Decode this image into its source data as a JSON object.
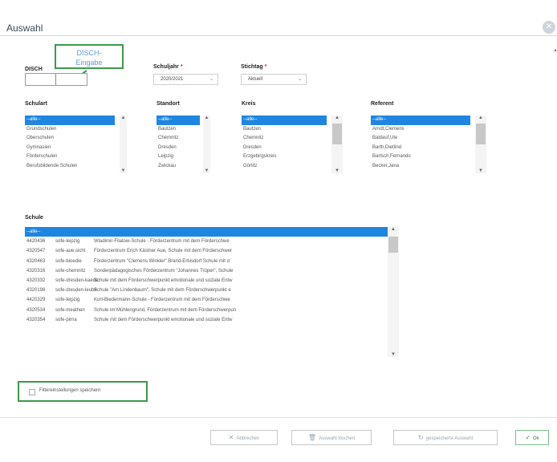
{
  "window": {
    "title": "Auswahl"
  },
  "callout": {
    "line1": "DISCH-",
    "line2": "Eingabe"
  },
  "fields": {
    "disch_label": "DISCH",
    "schuljahr_label": "Schuljahr",
    "schuljahr_value": "2020/2021",
    "stichtag_label": "Stichtag",
    "stichtag_value": "Aktuell",
    "required_mark": "*"
  },
  "lists": {
    "schulart": {
      "label": "Schulart",
      "items": [
        "--alle--",
        "Grundschulen",
        "Oberschulen",
        "Gymnasien",
        "Förderschulen",
        "Berufsbildende Schulen"
      ]
    },
    "standort": {
      "label": "Standort",
      "items": [
        "--alle--",
        "Bautzen",
        "Chemnitz",
        "Dresden",
        "Leipzig",
        "Zwickau"
      ]
    },
    "kreis": {
      "label": "Kreis",
      "items": [
        "--alle--",
        "Bautzen",
        "Chemnitz",
        "Dresden",
        "Erzgebirgskreis",
        "Görlitz"
      ]
    },
    "referent": {
      "label": "Referent",
      "items": [
        "--alle--",
        "Arndt,Clemens",
        "Baldauf,Ute",
        "Barth,Dietlind",
        "Bartsch,Fernando",
        "Becker,Jana"
      ]
    }
  },
  "schule": {
    "label": "Schule",
    "all_item": "--alle--",
    "rows": [
      {
        "id": "4420436",
        "code": "sofe-leipzig",
        "name": "Wladimir-Filatow-Schule - Förderzentrum mit dem Förderschwe"
      },
      {
        "id": "4320547",
        "code": "sofe-aue.sicht",
        "name": "Förderzentrum Erich Kästner Aue, Schule mit dem Förderschwer"
      },
      {
        "id": "4320463",
        "code": "sofe-bioedie",
        "name": "Förderzentrum \"Clemens Winkler\" Brand-Erbisdorf Schule mit d"
      },
      {
        "id": "4320316",
        "code": "sofe-chemnitz",
        "name": "Sonderpädagogisches Förderzentrum \"Johannes Trüper\", Schule"
      },
      {
        "id": "4320332",
        "code": "sofe-dresden-kaede",
        "name": "Schule mit dem Förderschwerpunkt emotionale und soziale Entw"
      },
      {
        "id": "4320198",
        "code": "sofe-dresden-leube",
        "name": "Schule \"Am Lindenbaum\", Schule mit dem Förderschwerpunkt e"
      },
      {
        "id": "4420329",
        "code": "sofe-leipzig",
        "name": "Kurt-Biedermann-Schule - Förderzentrum mit dem Förderschwe"
      },
      {
        "id": "4320534",
        "code": "sofe-meathen",
        "name": "Schule im Mühlengrund, Förderzentrum mit dem Förderschwerpun"
      },
      {
        "id": "4320354",
        "code": "sofe-pirna",
        "name": "Schule mit dem Förderschwerpunkt emotionale und soziale Entw"
      }
    ]
  },
  "save_filter": {
    "label": "Filtereinstellungen speichern"
  },
  "buttons": {
    "cancel": "Abbrechen",
    "clear": "Auswahl löschen",
    "saved": "gespeicherte Auswahl",
    "ok": "Ok"
  },
  "icons": {
    "close": "close-icon",
    "cancel": "x-icon",
    "clear": "trash-icon",
    "saved": "refresh-icon",
    "ok": "check-icon",
    "chevron": "chevron-down-icon"
  },
  "colors": {
    "selection": "#1f86e0",
    "highlight_border": "#3c9a4a",
    "callout_text": "#5c9ae0",
    "required": "#e02020"
  }
}
